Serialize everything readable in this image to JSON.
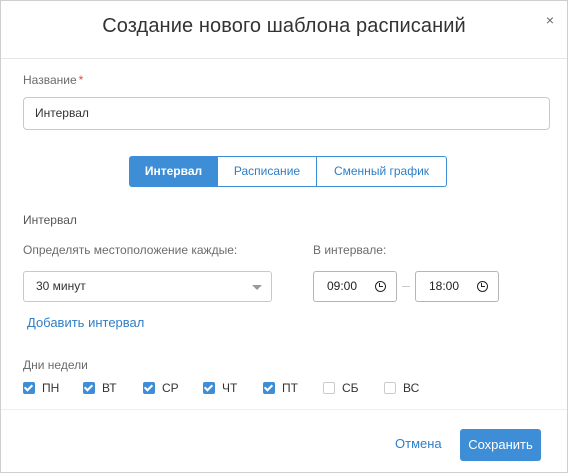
{
  "dialog": {
    "title": "Создание нового шаблона расписаний",
    "close_glyph": "×"
  },
  "name_field": {
    "label": "Название",
    "required_mark": "*",
    "value": "Интервал"
  },
  "mode_tabs": [
    {
      "label": "Интервал",
      "active": true
    },
    {
      "label": "Расписание",
      "active": false
    },
    {
      "label": "Сменный график",
      "active": false
    }
  ],
  "interval": {
    "section_title": "Интервал",
    "frequency_label": "Определять местоположение каждые:",
    "frequency_value": "30 минут",
    "range_label": "В интервале:",
    "from_time": "09:00",
    "to_time": "18:00",
    "add_interval_link": "Добавить интервал"
  },
  "weekdays": {
    "label": "Дни недели",
    "days": [
      {
        "label": "ПН",
        "checked": true
      },
      {
        "label": "ВТ",
        "checked": true
      },
      {
        "label": "СР",
        "checked": true
      },
      {
        "label": "ЧТ",
        "checked": true
      },
      {
        "label": "ПТ",
        "checked": true
      },
      {
        "label": "СБ",
        "checked": false
      },
      {
        "label": "ВС",
        "checked": false
      }
    ]
  },
  "footer": {
    "cancel_label": "Отмена",
    "save_label": "Сохранить"
  },
  "colors": {
    "accent": "#3d8ed6",
    "link": "#2f7ec6",
    "required": "#e04848"
  }
}
